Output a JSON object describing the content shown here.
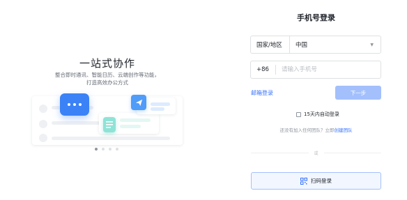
{
  "promo": {
    "title": "一站式协作",
    "desc_line1": "整合即时通讯、智能日历、云端创作等功能，",
    "desc_line2": "打造高效办公方式",
    "carousel_count": 4,
    "carousel_active": 1
  },
  "login": {
    "title": "手机号登录",
    "region": {
      "label": "国家/地区",
      "value": "中国"
    },
    "phone": {
      "code": "+86",
      "placeholder": "请输入手机号"
    },
    "email_link": "邮箱登录",
    "next_button": "下一步",
    "auto_login": "15天内自动登录",
    "join_text": "还没有加入任何团队？立即",
    "join_link": "创建团队",
    "divider_text": "或",
    "scan_button": "扫码登录"
  },
  "colors": {
    "accent": "#3370ff",
    "disabled_button": "#a3c0fc",
    "illustration_blue": "#3b82f6"
  }
}
